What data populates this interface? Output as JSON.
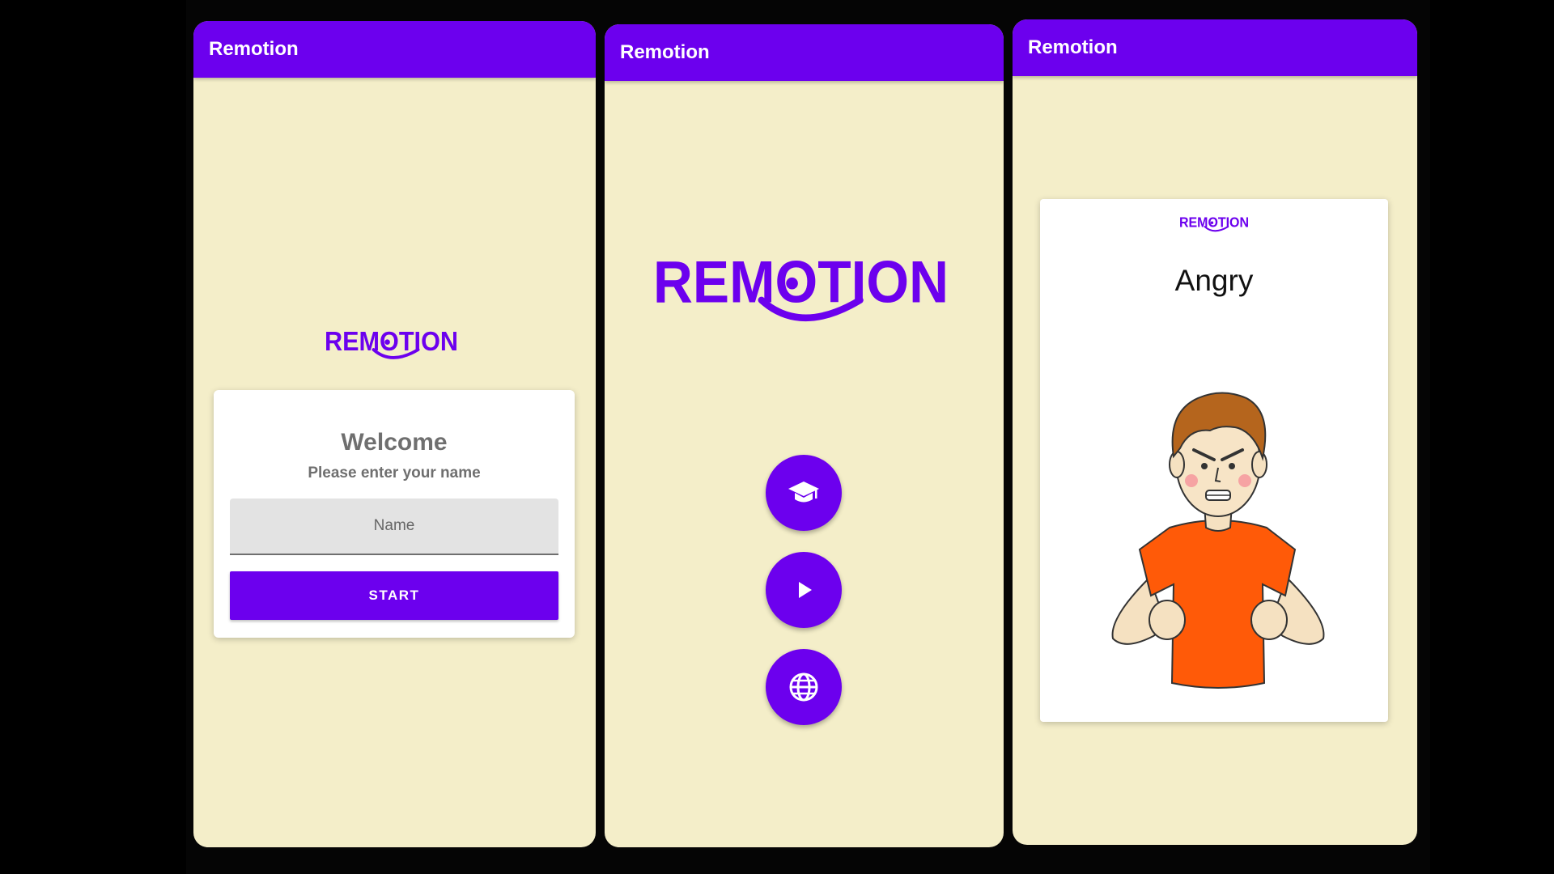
{
  "colors": {
    "accent": "#6c00ee",
    "screen_background": "#f4eec9",
    "card_background": "#ffffff",
    "text_muted": "#6f6f6f"
  },
  "screens": [
    {
      "app_bar_title": "Remotion",
      "logo_text": "REMOTION",
      "welcome": {
        "title": "Welcome",
        "subtitle": "Please enter your name",
        "name_placeholder": "Name",
        "name_value": "",
        "start_label": "START"
      }
    },
    {
      "app_bar_title": "Remotion",
      "logo_text": "REMOTION",
      "menu_buttons": [
        {
          "icon": "graduation-cap-icon"
        },
        {
          "icon": "play-icon"
        },
        {
          "icon": "globe-icon"
        }
      ]
    },
    {
      "app_bar_title": "Remotion",
      "logo_text": "REMOTION",
      "emotion_card": {
        "emotion": "Angry",
        "illustration": "angry-boy-illustration"
      }
    }
  ]
}
